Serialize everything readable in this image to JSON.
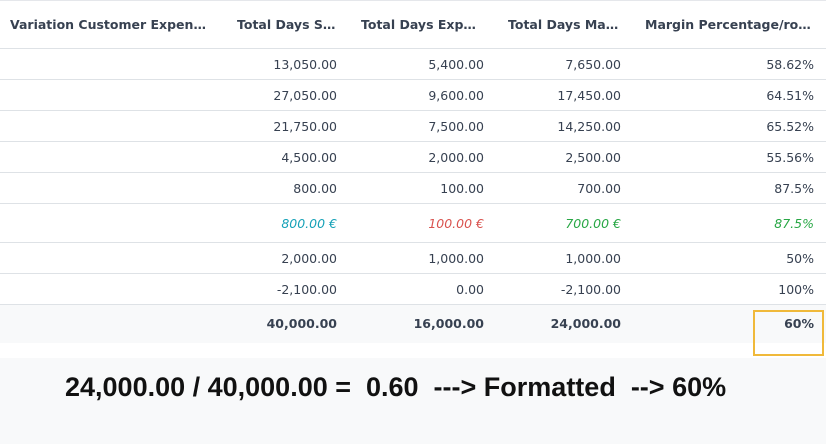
{
  "table": {
    "columns": [
      "Variation Customer Expense ...",
      "Total Days S...",
      "Total Days Expen...",
      "Total Days Mar...",
      "Margin Percentage/role..."
    ],
    "rows": [
      {
        "cells": [
          "",
          "13,050.00",
          "5,400.00",
          "7,650.00",
          "58.62%"
        ]
      },
      {
        "cells": [
          "",
          "27,050.00",
          "9,600.00",
          "17,450.00",
          "64.51%"
        ]
      },
      {
        "cells": [
          "",
          "21,750.00",
          "7,500.00",
          "14,250.00",
          "65.52%"
        ]
      },
      {
        "cells": [
          "",
          "4,500.00",
          "2,000.00",
          "2,500.00",
          "55.56%"
        ]
      },
      {
        "cells": [
          "",
          "800.00",
          "100.00",
          "700.00",
          "87.5%"
        ]
      },
      {
        "cells": [
          "",
          "800.00 €",
          "100.00 €",
          "700.00 €",
          "87.5%"
        ],
        "highlight": true
      },
      {
        "cells": [
          "",
          "2,000.00",
          "1,000.00",
          "1,000.00",
          "50%"
        ]
      },
      {
        "cells": [
          "",
          "-2,100.00",
          "0.00",
          "-2,100.00",
          "100%"
        ]
      }
    ],
    "totals": [
      "",
      "40,000.00",
      "16,000.00",
      "24,000.00",
      "60%"
    ]
  },
  "annotation": "24,000.00 / 40,000.00 =  0.60  ---> Formatted  --> 60%",
  "colors": {
    "highlight_col1": "#17a2b8",
    "highlight_col2": "#d9534f",
    "highlight_col3": "#28a745",
    "highlight_col4": "#28a745",
    "callout_border": "#f0b93a"
  }
}
